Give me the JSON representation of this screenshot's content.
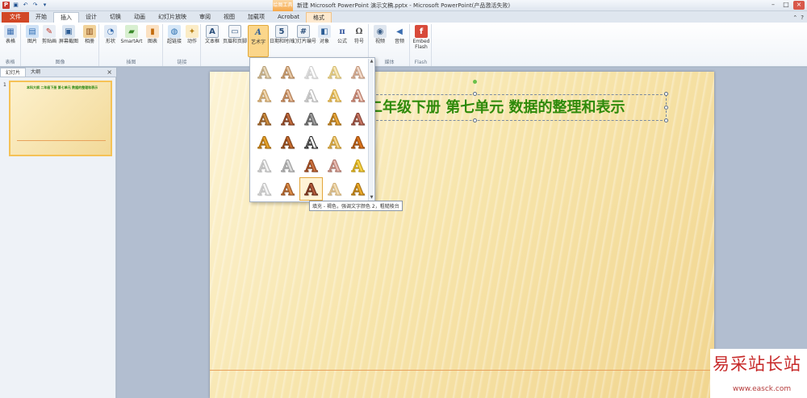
{
  "window": {
    "title": "新建 Microsoft PowerPoint 演示文稿.pptx - Microsoft PowerPoint(产品激活失败)",
    "context_tool_label": "绘图工具"
  },
  "tabs": [
    "文件",
    "开始",
    "插入",
    "设计",
    "切换",
    "动画",
    "幻灯片放映",
    "审阅",
    "视图",
    "加载项",
    "Acrobat",
    "格式"
  ],
  "ribbon": {
    "groups": {
      "tables": "表格",
      "images": "图像",
      "illustrations": "插图",
      "links": "链接",
      "media": "媒体",
      "flash": "Flash"
    },
    "buttons": {
      "table": "表格",
      "picture": "图片",
      "clipart": "剪贴画",
      "screenshot": "屏幕截图",
      "album": "相册",
      "shapes": "形状",
      "smartart": "SmartArt",
      "chart": "图表",
      "hyperlink": "超链接",
      "action": "动作",
      "textbox": "文本框",
      "header_footer": "页眉和页脚",
      "wordart": "艺术字",
      "datetime": "日期和时间",
      "slide_number": "幻灯片编号",
      "object": "对象",
      "equation": "公式",
      "symbol": "符号",
      "video": "视频",
      "audio": "音频",
      "embed_flash": "Embed Flash"
    }
  },
  "pane": {
    "tab_slides": "幻灯片",
    "tab_outline": "大纲",
    "slide_number": "1",
    "thumb_title": "本科大纲 二年级下册 第七单元 数据的整理和表示"
  },
  "slide": {
    "title": "二年级下册  第七单元  数据的整理和表示"
  },
  "wordart_gallery": {
    "tooltip": "填充 - 褐色，强调文字颜色 2，粗糙棱台",
    "styles": [
      {
        "c": "#e6d6b8",
        "s": "#b9a27a"
      },
      {
        "c": "#e4c7a6",
        "s": "#b48456"
      },
      {
        "c": "#ffffff",
        "s": "#cfcfcf"
      },
      {
        "c": "#f7e7b8",
        "s": "#d6bd70"
      },
      {
        "c": "#f1d9c9",
        "s": "#c4977b"
      },
      {
        "c": "#f0d7b0",
        "s": "#c49a5e"
      },
      {
        "c": "#e8c1a0",
        "s": "#b07446"
      },
      {
        "c": "#ffffff",
        "s": "#b8b8b8"
      },
      {
        "c": "#f6dd98",
        "s": "#d3a43c"
      },
      {
        "c": "#f0cfc2",
        "s": "#b46e5a"
      },
      {
        "c": "#c98a3d",
        "s": "#8a5420"
      },
      {
        "c": "#c06a3c",
        "s": "#7b3a1c"
      },
      {
        "c": "#9a9a9a",
        "s": "#5a5a5a"
      },
      {
        "c": "#e6a53b",
        "s": "#a66d13"
      },
      {
        "c": "#c57462",
        "s": "#843f30"
      },
      {
        "c": "#e2a12c",
        "s": "#a86a0d"
      },
      {
        "c": "#c46b2f",
        "s": "#7e3c12"
      },
      {
        "c": "#ffffff",
        "s": "#222222"
      },
      {
        "c": "#f2d38a",
        "s": "#c4932c"
      },
      {
        "c": "#d8731c",
        "s": "#9a4a0c"
      },
      {
        "c": "#f4f4f4",
        "s": "#b8b8b8"
      },
      {
        "c": "#dcdcdc",
        "s": "#9a9a9a"
      },
      {
        "c": "#c9703e",
        "s": "#8a3e18"
      },
      {
        "c": "#e7b9b0",
        "s": "#b0766a"
      },
      {
        "c": "#f4d04a",
        "s": "#c49a0e"
      },
      {
        "c": "#f4f4f4",
        "s": "#c0c0c0"
      },
      {
        "c": "#d98a47",
        "s": "#9a5320"
      },
      {
        "c": "#b05a3a",
        "s": "#6b2c16"
      },
      {
        "c": "#f2dcb3",
        "s": "#d2b27a"
      },
      {
        "c": "#e8a82a",
        "s": "#a86f0c"
      }
    ]
  },
  "watermark": {
    "title": "易采站长站",
    "url": "www.easck.com"
  }
}
